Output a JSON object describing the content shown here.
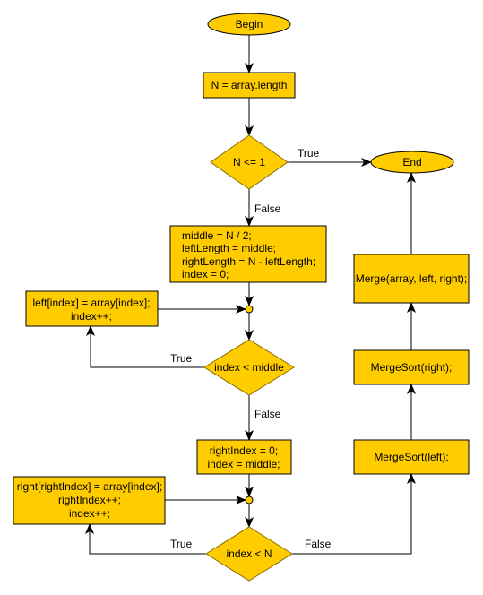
{
  "colors": {
    "node_fill": "#FFCC00",
    "stroke": "#000000"
  },
  "nodes": {
    "begin": "Begin",
    "n_assign": "N = array.length",
    "cond_n": "N <= 1",
    "end": "End",
    "init": [
      "middle = N / 2;",
      "leftLength = middle;",
      "rightLength = N - leftLength;",
      "index = 0;"
    ],
    "left_copy": [
      "left[index] = array[index];",
      "index++;"
    ],
    "cond_middle": "index < middle",
    "right_init": [
      "rightIndex = 0;",
      "index = middle;"
    ],
    "right_copy": [
      "right[rightIndex] = array[index];",
      "rightIndex++;",
      "index++;"
    ],
    "cond_n2": "index < N",
    "sort_left": "MergeSort(left);",
    "sort_right": "MergeSort(right);",
    "merge": "Merge(array, left, right);"
  },
  "labels": {
    "true1": "True",
    "false1": "False",
    "true2": "True",
    "false2": "False",
    "true3": "True",
    "false3": "False"
  }
}
